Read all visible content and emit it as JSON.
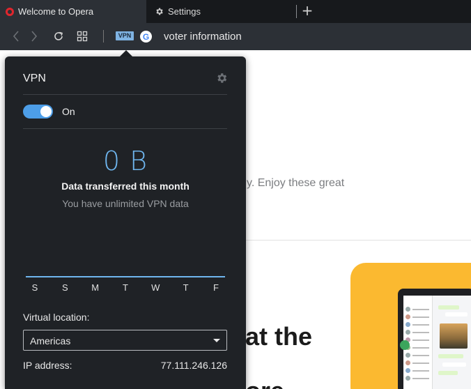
{
  "tabs": [
    {
      "label": "Welcome to Opera",
      "icon": "opera-icon",
      "active": true
    },
    {
      "label": "Settings",
      "icon": "gear-icon",
      "active": false
    }
  ],
  "toolbar": {
    "vpn_badge": "VPN",
    "search_engine_icon": "G",
    "address": "voter information"
  },
  "page": {
    "partial_text": "ully. Enjoy these great",
    "headline": "at the",
    "headline2": "ore"
  },
  "vpn_popup": {
    "title": "VPN",
    "toggle_label": "On",
    "toggle_on": true,
    "data_value": "0 B",
    "data_label": "Data transferred this month",
    "data_subtext": "You have unlimited VPN data",
    "weekdays": [
      "S",
      "S",
      "M",
      "T",
      "W",
      "T",
      "F"
    ],
    "location_label": "Virtual location:",
    "location_value": "Americas",
    "ip_label": "IP address:",
    "ip_value": "77.111.246.126"
  },
  "colors": {
    "accent": "#6fb6ef",
    "toggle": "#4d9ee8",
    "popup_bg": "#1f2226",
    "card": "#fbb930"
  }
}
